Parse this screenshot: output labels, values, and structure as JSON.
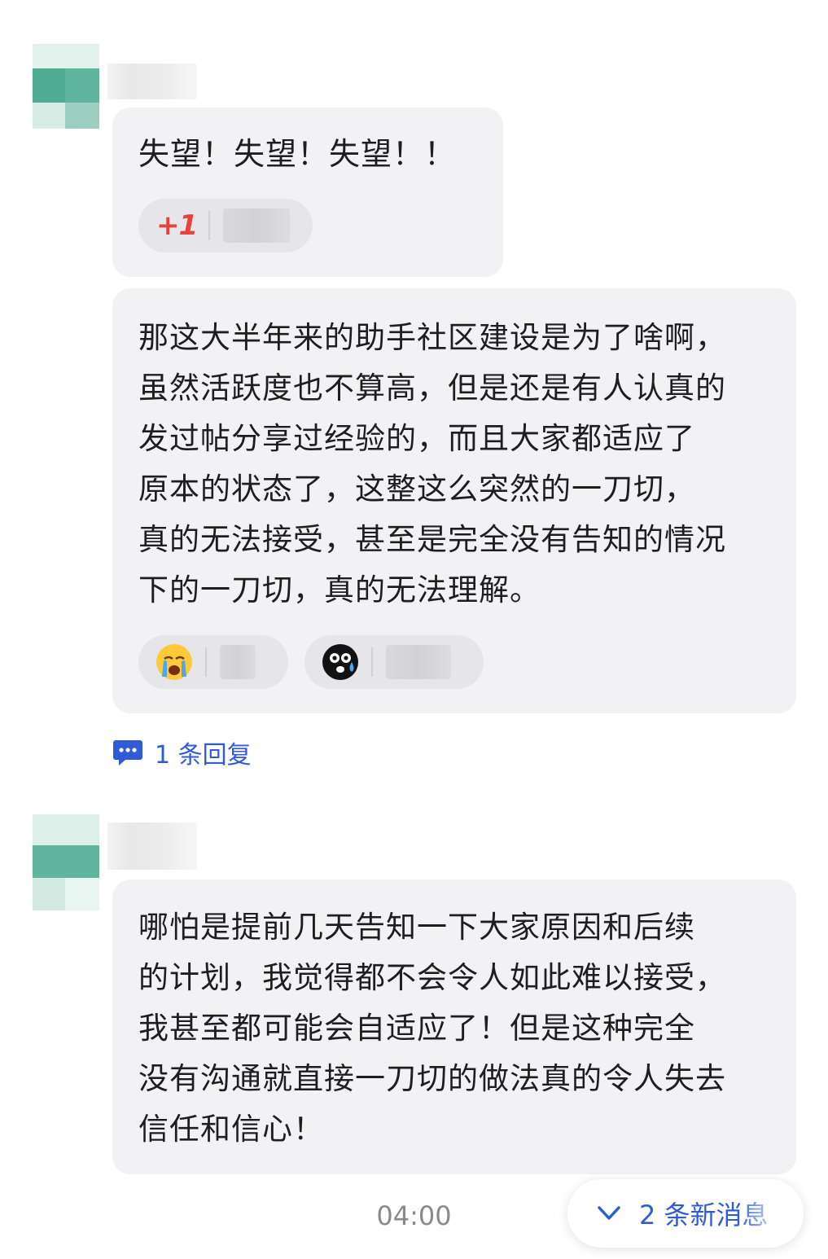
{
  "messages": [
    {
      "text": "失望！失望！失望！！",
      "reactions": [
        {
          "emoji": "+1"
        }
      ]
    },
    {
      "text": "那这大半年来的助手社区建设是为了啥啊，\n虽然活跃度也不算高，但是还是有人认真的\n发过帖分享过经验的，而且大家都适应了\n原本的状态了，这整这么突然的一刀切，\n真的无法接受，甚至是完全没有告知的情况\n下的一刀切，真的无法理解。",
      "reactions": [
        {
          "emoji": "crying-face-icon"
        },
        {
          "emoji": "sweat-face-icon"
        }
      ]
    },
    {
      "text": "哪怕是提前几天告知一下大家原因和后续\n的计划，我觉得都不会令人如此难以接受，\n我甚至都可能会自适应了！但是这种完全\n没有沟通就直接一刀切的做法真的令人失去\n信任和信心！"
    }
  ],
  "reply_link": "1 条回复",
  "timestamp": "04:00",
  "new_messages_button": "2 条新消息",
  "colors": {
    "accent": "#2f5bd8",
    "bubble": "#f2f2f5",
    "avatar": "#5fb59e"
  }
}
